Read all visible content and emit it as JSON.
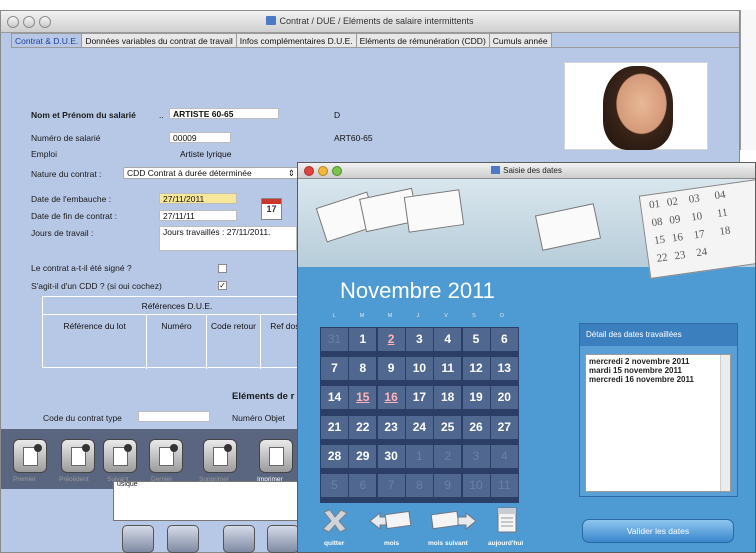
{
  "main_window": {
    "title": "Contrat  / DUE / Eléments de salaire intermittents",
    "tabs": [
      "Contrat & D.U.E.",
      "Données variables du contrat de travail",
      "Infos complémentaires D.U.E.",
      "Eléments de rémunération (CDD)",
      "Cumuls année"
    ]
  },
  "form": {
    "name_label": "Nom et Prénom du salarié",
    "name_prefix": "..",
    "name_value": "ARTISTE 60-65",
    "name_suffix": "D",
    "employee_number_label": "Numéro de salarié",
    "employee_number_value": "00009",
    "employee_code": "ART60-65",
    "job_label": "Emploi",
    "job_value": "Artiste lyrique",
    "contract_nature_label": "Nature du contrat :",
    "contract_nature_value": "CDD Contrat à durée déterminée",
    "hire_date_label": "Date de l'embauche :",
    "hire_date_value": "27/11/2011",
    "calendar_icon_day": "17",
    "end_date_label": "Date de fin de contrat :",
    "end_date_value": "27/11/11",
    "work_days_label": "Jours de travail :",
    "work_days_value": "Jours travaillés : 27/11/2011.",
    "signed_label": "Le contrat a-t-il été signé ?",
    "cdd_label": "S'agit-il d'un CDD ? (si oui cochez)",
    "cdd_check": "✓",
    "references_title": "Références D.U.E.",
    "references_columns": [
      "Référence du lot",
      "Numéro",
      "Code retour",
      "Ref doss"
    ],
    "elements_title": "Eléments de r",
    "contract_type_code_label": "Code du contrat type",
    "object_number_label": "Numéro Objet"
  },
  "toolbar": {
    "captions": [
      "Premier",
      "Précédent",
      "Suivant",
      "Dernier",
      "Supprimer",
      "Imprimer"
    ],
    "strip_label": "usique"
  },
  "dialog": {
    "title": "Saisie des dates",
    "header_page_numbers": [
      "01",
      "02",
      "03",
      "04",
      "08",
      "09",
      "10",
      "11",
      "15",
      "16",
      "17",
      "18",
      "22",
      "23",
      "24"
    ],
    "month": "Novembre 2011",
    "weekdays": [
      "L",
      "M",
      "M",
      "J",
      "V",
      "S",
      "D"
    ],
    "weeks": [
      [
        "31",
        "1",
        "2",
        "3",
        "4",
        "5",
        "6"
      ],
      [
        "7",
        "8",
        "9",
        "10",
        "11",
        "12",
        "13"
      ],
      [
        "14",
        "15",
        "16",
        "17",
        "18",
        "19",
        "20"
      ],
      [
        "21",
        "22",
        "23",
        "24",
        "25",
        "26",
        "27"
      ],
      [
        "28",
        "29",
        "30",
        "1",
        "2",
        "3",
        "4"
      ],
      [
        "5",
        "6",
        "7",
        "8",
        "9",
        "10",
        "11"
      ]
    ],
    "detail_title": "Détail des dates travaillées",
    "worked_dates": [
      "mercredi 2 novembre 2011",
      "mardi 15 novembre 2011",
      "mercredi 16 novembre 2011"
    ],
    "buttons": {
      "quit": "quitter",
      "prev_month": "mois",
      "next_month": "mois suivant",
      "today": "aujourd'hui",
      "validate": "Valider les dates"
    }
  }
}
